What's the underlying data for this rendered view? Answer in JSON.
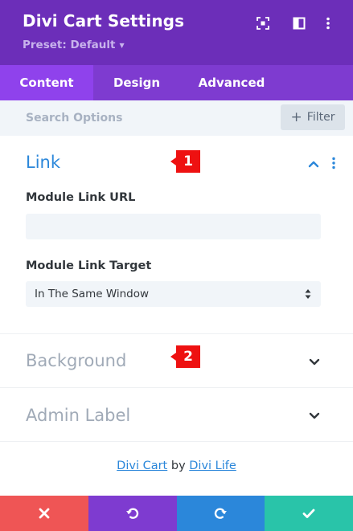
{
  "header": {
    "title": "Divi Cart Settings",
    "preset_label": "Preset: Default",
    "icons": [
      "focus-icon",
      "sidebar-toggle-icon",
      "more-vertical-icon"
    ],
    "bg_color": "#6c2eb9"
  },
  "tabs": [
    {
      "label": "Content",
      "active": true
    },
    {
      "label": "Design",
      "active": false
    },
    {
      "label": "Advanced",
      "active": false
    }
  ],
  "search": {
    "placeholder": "Search Options",
    "filter_label": "Filter"
  },
  "sections": {
    "link": {
      "title": "Link",
      "expanded": true,
      "url_label": "Module Link URL",
      "url_value": "",
      "target_label": "Module Link Target",
      "target_value": "In The Same Window"
    },
    "background": {
      "title": "Background",
      "expanded": false
    },
    "admin_label": {
      "title": "Admin Label",
      "expanded": false
    }
  },
  "annotations": [
    "1",
    "2"
  ],
  "credit": {
    "product": "Divi Cart",
    "by": "by",
    "author": "Divi Life"
  },
  "actions": [
    {
      "icon": "close-icon",
      "color": "#ef5555"
    },
    {
      "icon": "undo-icon",
      "color": "#7e3bd0"
    },
    {
      "icon": "redo-icon",
      "color": "#2b87da"
    },
    {
      "icon": "check-icon",
      "color": "#29c4a9"
    }
  ],
  "colors": {
    "accent_blue": "#2b87da",
    "tab_active": "#8f42ec",
    "tab_bar": "#7e3bd0",
    "annotation_red": "#ee1111"
  }
}
